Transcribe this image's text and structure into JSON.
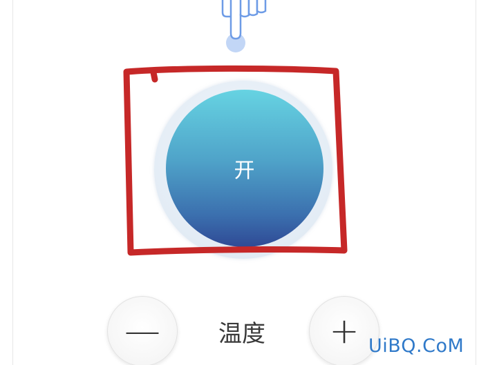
{
  "power": {
    "label": "开"
  },
  "temperature": {
    "label": "温度",
    "decrease_glyph": "—",
    "increase_glyph": "+"
  },
  "watermark": {
    "text": "UiBQ.CoM"
  },
  "colors": {
    "button_gradient_top": "#66d3e2",
    "button_gradient_bottom": "#2f4a95",
    "annotation": "#c62828",
    "watermark": "#2f79c9"
  },
  "icons": {
    "tap_hint": "pointing-hand-icon"
  }
}
